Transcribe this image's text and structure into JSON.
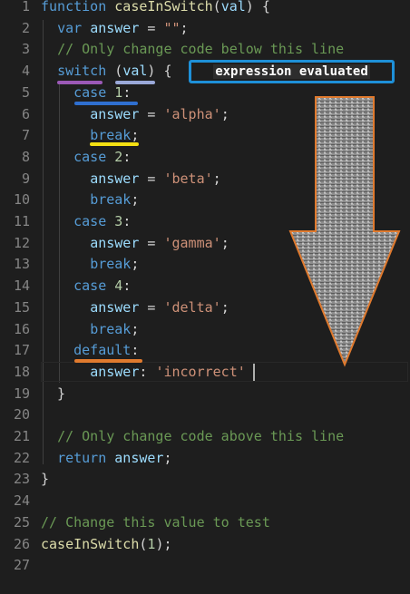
{
  "lines": [
    {
      "n": "1",
      "tokens": [
        [
          "kw",
          "function"
        ],
        [
          "pun",
          " "
        ],
        [
          "fn",
          "caseInSwitch"
        ],
        [
          "pun",
          "("
        ],
        [
          "var",
          "val"
        ],
        [
          "pun",
          ") {"
        ]
      ]
    },
    {
      "n": "2",
      "tokens": [
        [
          "pun",
          "  "
        ],
        [
          "kw",
          "var"
        ],
        [
          "pun",
          " "
        ],
        [
          "var",
          "answer"
        ],
        [
          "pun",
          " = "
        ],
        [
          "str",
          "\"\""
        ],
        [
          "pun",
          ";"
        ]
      ]
    },
    {
      "n": "3",
      "tokens": [
        [
          "pun",
          "  "
        ],
        [
          "cmt",
          "// Only change code below this line"
        ]
      ]
    },
    {
      "n": "4",
      "tokens": [
        [
          "pun",
          "  "
        ],
        [
          "kw",
          "switch"
        ],
        [
          "pun",
          " ("
        ],
        [
          "var",
          "val"
        ],
        [
          "pun",
          ") {"
        ]
      ]
    },
    {
      "n": "5",
      "tokens": [
        [
          "pun",
          "    "
        ],
        [
          "kw",
          "case"
        ],
        [
          "pun",
          " "
        ],
        [
          "num",
          "1"
        ],
        [
          "pun",
          ":"
        ]
      ]
    },
    {
      "n": "6",
      "tokens": [
        [
          "pun",
          "      "
        ],
        [
          "var",
          "answer"
        ],
        [
          "pun",
          " = "
        ],
        [
          "str",
          "'alpha'"
        ],
        [
          "pun",
          ";"
        ]
      ]
    },
    {
      "n": "7",
      "tokens": [
        [
          "pun",
          "      "
        ],
        [
          "kw",
          "break"
        ],
        [
          "pun",
          ";"
        ]
      ]
    },
    {
      "n": "8",
      "tokens": [
        [
          "pun",
          "    "
        ],
        [
          "kw",
          "case"
        ],
        [
          "pun",
          " "
        ],
        [
          "num",
          "2"
        ],
        [
          "pun",
          ":"
        ]
      ]
    },
    {
      "n": "9",
      "tokens": [
        [
          "pun",
          "      "
        ],
        [
          "var",
          "answer"
        ],
        [
          "pun",
          " = "
        ],
        [
          "str",
          "'beta'"
        ],
        [
          "pun",
          ";"
        ]
      ]
    },
    {
      "n": "10",
      "tokens": [
        [
          "pun",
          "      "
        ],
        [
          "kw",
          "break"
        ],
        [
          "pun",
          ";"
        ]
      ]
    },
    {
      "n": "11",
      "tokens": [
        [
          "pun",
          "    "
        ],
        [
          "kw",
          "case"
        ],
        [
          "pun",
          " "
        ],
        [
          "num",
          "3"
        ],
        [
          "pun",
          ":"
        ]
      ]
    },
    {
      "n": "12",
      "tokens": [
        [
          "pun",
          "      "
        ],
        [
          "var",
          "answer"
        ],
        [
          "pun",
          " = "
        ],
        [
          "str",
          "'gamma'"
        ],
        [
          "pun",
          ";"
        ]
      ]
    },
    {
      "n": "13",
      "tokens": [
        [
          "pun",
          "      "
        ],
        [
          "kw",
          "break"
        ],
        [
          "pun",
          ";"
        ]
      ]
    },
    {
      "n": "14",
      "tokens": [
        [
          "pun",
          "    "
        ],
        [
          "kw",
          "case"
        ],
        [
          "pun",
          " "
        ],
        [
          "num",
          "4"
        ],
        [
          "pun",
          ":"
        ]
      ]
    },
    {
      "n": "15",
      "tokens": [
        [
          "pun",
          "      "
        ],
        [
          "var",
          "answer"
        ],
        [
          "pun",
          " = "
        ],
        [
          "str",
          "'delta'"
        ],
        [
          "pun",
          ";"
        ]
      ]
    },
    {
      "n": "16",
      "tokens": [
        [
          "pun",
          "      "
        ],
        [
          "kw",
          "break"
        ],
        [
          "pun",
          ";"
        ]
      ]
    },
    {
      "n": "17",
      "tokens": [
        [
          "pun",
          "    "
        ],
        [
          "kw",
          "default"
        ],
        [
          "pun",
          ":"
        ]
      ]
    },
    {
      "n": "18",
      "tokens": [
        [
          "pun",
          "      "
        ],
        [
          "var",
          "answer"
        ],
        [
          "pun",
          ": "
        ],
        [
          "str",
          "'incorrect'"
        ]
      ]
    },
    {
      "n": "19",
      "tokens": [
        [
          "pun",
          "  }"
        ]
      ]
    },
    {
      "n": "20",
      "tokens": []
    },
    {
      "n": "21",
      "tokens": [
        [
          "pun",
          "  "
        ],
        [
          "cmt",
          "// Only change code above this line"
        ]
      ]
    },
    {
      "n": "22",
      "tokens": [
        [
          "pun",
          "  "
        ],
        [
          "kw",
          "return"
        ],
        [
          "pun",
          " "
        ],
        [
          "var",
          "answer"
        ],
        [
          "pun",
          ";"
        ]
      ]
    },
    {
      "n": "23",
      "tokens": [
        [
          "pun",
          "}"
        ]
      ]
    },
    {
      "n": "24",
      "tokens": []
    },
    {
      "n": "25",
      "tokens": [
        [
          "cmt",
          "// Change this value to test"
        ]
      ]
    },
    {
      "n": "26",
      "tokens": [
        [
          "fn",
          "caseInSwitch"
        ],
        [
          "pun",
          "("
        ],
        [
          "num",
          "1"
        ],
        [
          "pun",
          ");"
        ]
      ]
    },
    {
      "n": "27",
      "tokens": []
    }
  ],
  "annotation": {
    "label": "expression evaluated",
    "border_color": "#1e90d8",
    "arrow_fill": "#9a9a9a",
    "arrow_stroke": "#e07a2e"
  },
  "underline_colors": {
    "switch": "#9b59b6",
    "val": "#9aa8d8",
    "case1": "#2f6fd0",
    "break": "#f4e012",
    "default": "#e07a2e"
  },
  "colors": {
    "background": "#1e1e1e",
    "keyword": "#569cd6",
    "function": "#dcdcaa",
    "variable": "#9cdcfe",
    "string": "#ce9178",
    "number": "#b5cea8",
    "comment": "#6a9955",
    "line_number": "#858585"
  }
}
